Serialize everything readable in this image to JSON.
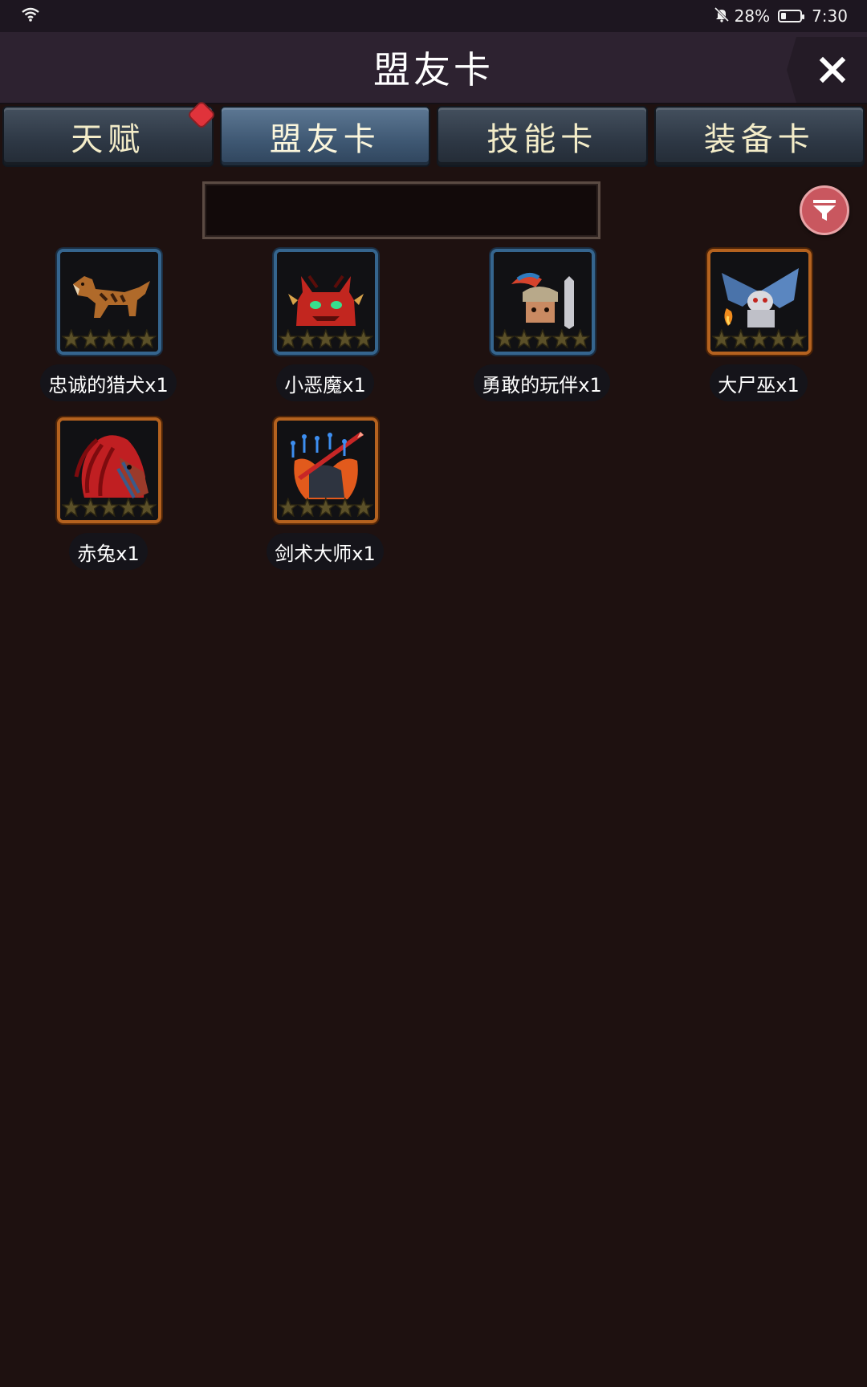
{
  "status_bar": {
    "battery_percent": "28%",
    "time": "7:30",
    "battery_level": 0.28,
    "icons": [
      "wifi-icon",
      "bell-off-icon",
      "battery-icon"
    ]
  },
  "header": {
    "title": "盟友卡",
    "close_icon": "close-icon"
  },
  "tabs": [
    {
      "label": "天赋",
      "active": false,
      "has_badge": true
    },
    {
      "label": "盟友卡",
      "active": true,
      "has_badge": false
    },
    {
      "label": "技能卡",
      "active": false,
      "has_badge": false
    },
    {
      "label": "装备卡",
      "active": false,
      "has_badge": false
    }
  ],
  "search": {
    "value": ""
  },
  "filter": {
    "icon": "filter-icon"
  },
  "cards": [
    {
      "label": "忠诚的猎犬x1",
      "frame": "blue",
      "icon": "hound-icon",
      "stars": 5
    },
    {
      "label": "小恶魔x1",
      "frame": "blue",
      "icon": "imp-icon",
      "stars": 5
    },
    {
      "label": "勇敢的玩伴x1",
      "frame": "blue",
      "icon": "warrior-icon",
      "stars": 5
    },
    {
      "label": "大尸巫x1",
      "frame": "orange",
      "icon": "lich-icon",
      "stars": 5
    },
    {
      "label": "赤兔x1",
      "frame": "orange",
      "icon": "red-horse-icon",
      "stars": 5
    },
    {
      "label": "剑术大师x1",
      "frame": "orange",
      "icon": "swordmaster-icon",
      "stars": 5
    }
  ],
  "colors": {
    "background": "#1e1110",
    "tab_active": "#3e5772",
    "tab_text": "#f3ecc8",
    "badge": "#e0333b",
    "filter_button": "#c9575f",
    "frame_blue": "#35658e",
    "frame_orange": "#b4621f"
  }
}
